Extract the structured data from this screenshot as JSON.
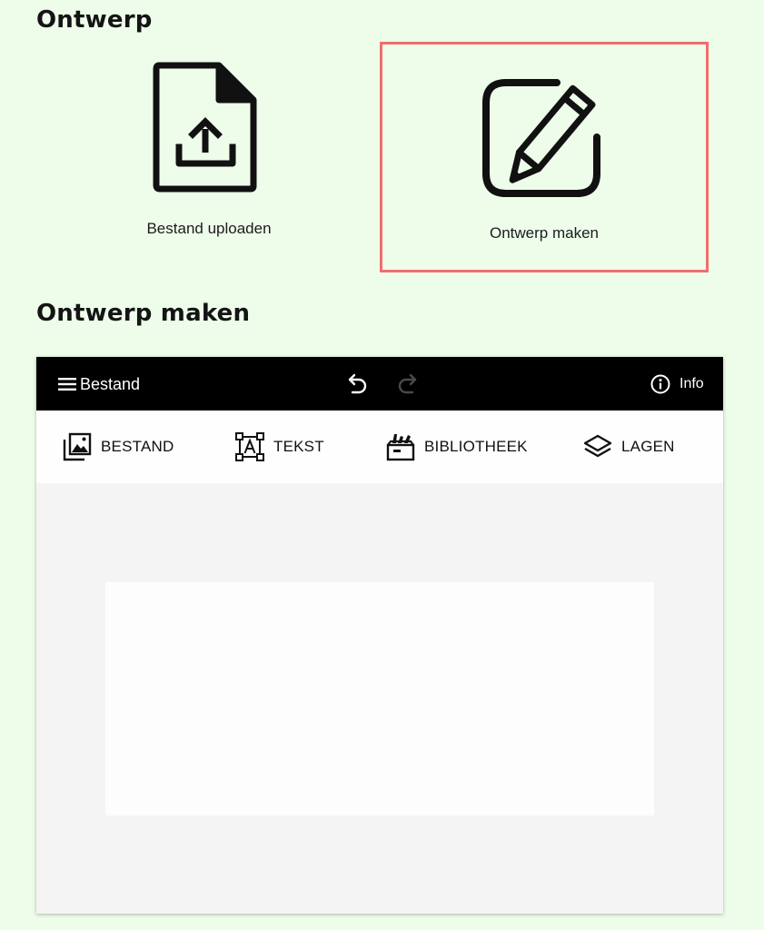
{
  "sections": {
    "design_title": "Ontwerp",
    "create_title": "Ontwerp maken"
  },
  "options": {
    "upload": {
      "label": "Bestand uploaden",
      "icon": "file-upload-icon"
    },
    "create": {
      "label": "Ontwerp maken",
      "icon": "edit-square-icon",
      "selected": true
    }
  },
  "editor": {
    "topbar": {
      "menu_label": "Bestand",
      "info_label": "Info",
      "undo_icon": "undo-icon",
      "redo_icon": "redo-icon",
      "redo_enabled": false
    },
    "toolbar": {
      "items": [
        {
          "label": "BESTAND",
          "icon": "image-stack-icon"
        },
        {
          "label": "TEKST",
          "icon": "text-box-icon"
        },
        {
          "label": "BIBLIOTHEEK",
          "icon": "library-box-icon"
        },
        {
          "label": "LAGEN",
          "icon": "layers-icon"
        }
      ]
    }
  },
  "colors": {
    "page_background": "#eefdea",
    "selected_border": "#f26d6d",
    "topbar_background": "#000000",
    "toolbar_background": "#fefefe",
    "workspace_background": "#f4f4f4",
    "canvas_background": "#fdfdfd"
  }
}
